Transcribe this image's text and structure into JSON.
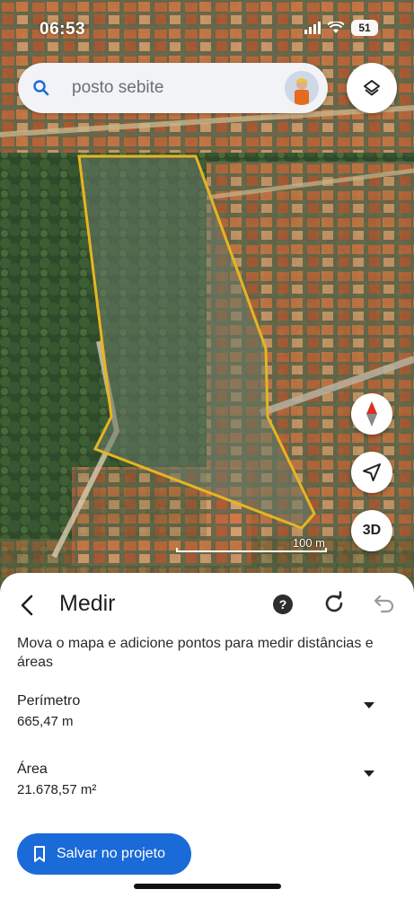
{
  "status": {
    "time": "06:53",
    "battery": "51"
  },
  "search": {
    "placeholder": "posto sebite"
  },
  "map": {
    "scale_label": "100 m",
    "three_d_label": "3D",
    "polygon_color": "#e8b422"
  },
  "panel": {
    "title": "Medir",
    "help_label": "?",
    "instructions": "Mova o mapa e adicione pontos para medir distâncias e áreas",
    "perimeter": {
      "label": "Perímetro",
      "value": "665,47 m"
    },
    "area": {
      "label": "Área",
      "value": "21.678,57 m²"
    },
    "save_label": "Salvar no projeto"
  },
  "colors": {
    "accent": "#1a6ad8"
  },
  "icons": [
    "search-icon",
    "layers-icon",
    "compass-icon",
    "navigation-arrow-icon",
    "back-arrow-icon",
    "help-icon",
    "refresh-icon",
    "undo-icon",
    "bookmark-icon",
    "dropdown-arrow-icon"
  ]
}
